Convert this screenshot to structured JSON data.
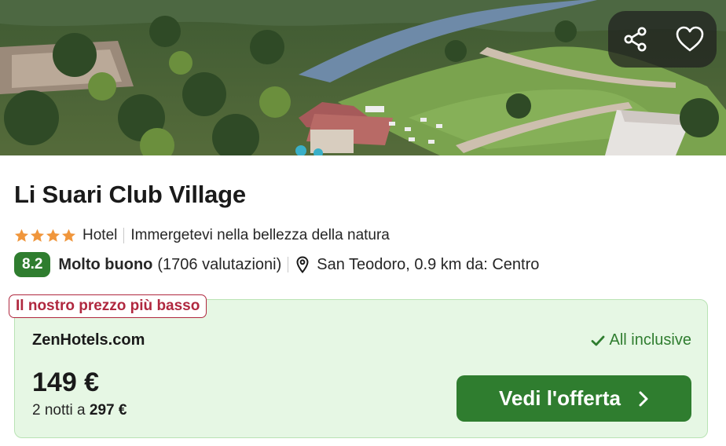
{
  "hotel": {
    "name": "Li Suari Club Village",
    "star_count": 4,
    "type": "Hotel",
    "tagline": "Immergetevi nella bellezza della natura",
    "score": "8.2",
    "rating_label": "Molto buono",
    "reviews": "(1706 valutazioni)",
    "location": "San Teodoro, 0.9 km da: Centro"
  },
  "photo": {
    "actions": [
      {
        "name": "share-icon"
      },
      {
        "name": "heart-icon"
      }
    ]
  },
  "offer": {
    "badge": "Il nostro prezzo più basso",
    "provider": "ZenHotels.com",
    "board": "All inclusive",
    "price": "149 €",
    "nights_prefix": "2 notti a",
    "total": "297 €",
    "cta_label": "Vedi l'offerta"
  },
  "colors": {
    "brand_green": "#2f7d2f",
    "offer_bg": "#e6f7e4",
    "badge_red": "#b0283f",
    "star": "#f0963c"
  }
}
